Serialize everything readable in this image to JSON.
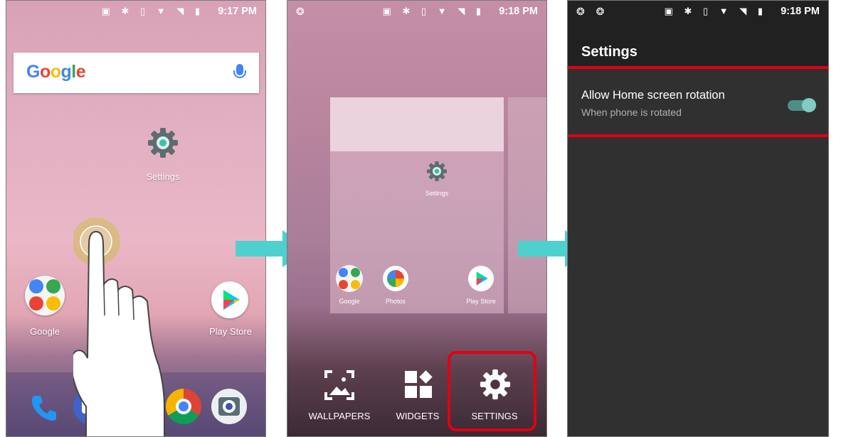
{
  "colors": {
    "accent_teal": "#4ed0cf",
    "highlight_red": "#e10012",
    "toggle_on": "#80cbc4"
  },
  "screen1": {
    "status": {
      "time": "9:17 PM",
      "icons": [
        "cast-icon",
        "bluetooth-icon",
        "vibrate-icon",
        "wifi-icon",
        "no-signal-icon",
        "battery-icon"
      ]
    },
    "search": {
      "logo": "Google",
      "mic_icon": "mic-icon"
    },
    "apps": [
      {
        "label": "Settings"
      },
      {
        "label": "Google"
      },
      {
        "label": "Play Store"
      }
    ],
    "gesture": "touch-hold-hand-icon"
  },
  "screen2": {
    "status": {
      "time": "9:18 PM"
    },
    "preview": {
      "settings_label": "Settings",
      "apps": [
        "Google",
        "Photos",
        "Play Store"
      ]
    },
    "options": [
      {
        "label": "WALLPAPERS"
      },
      {
        "label": "WIDGETS"
      },
      {
        "label": "SETTINGS"
      }
    ]
  },
  "screen3": {
    "status": {
      "time": "9:18 PM"
    },
    "title": "Settings",
    "preference": {
      "title": "Allow Home screen rotation",
      "summary": "When phone is rotated",
      "enabled": true
    }
  }
}
